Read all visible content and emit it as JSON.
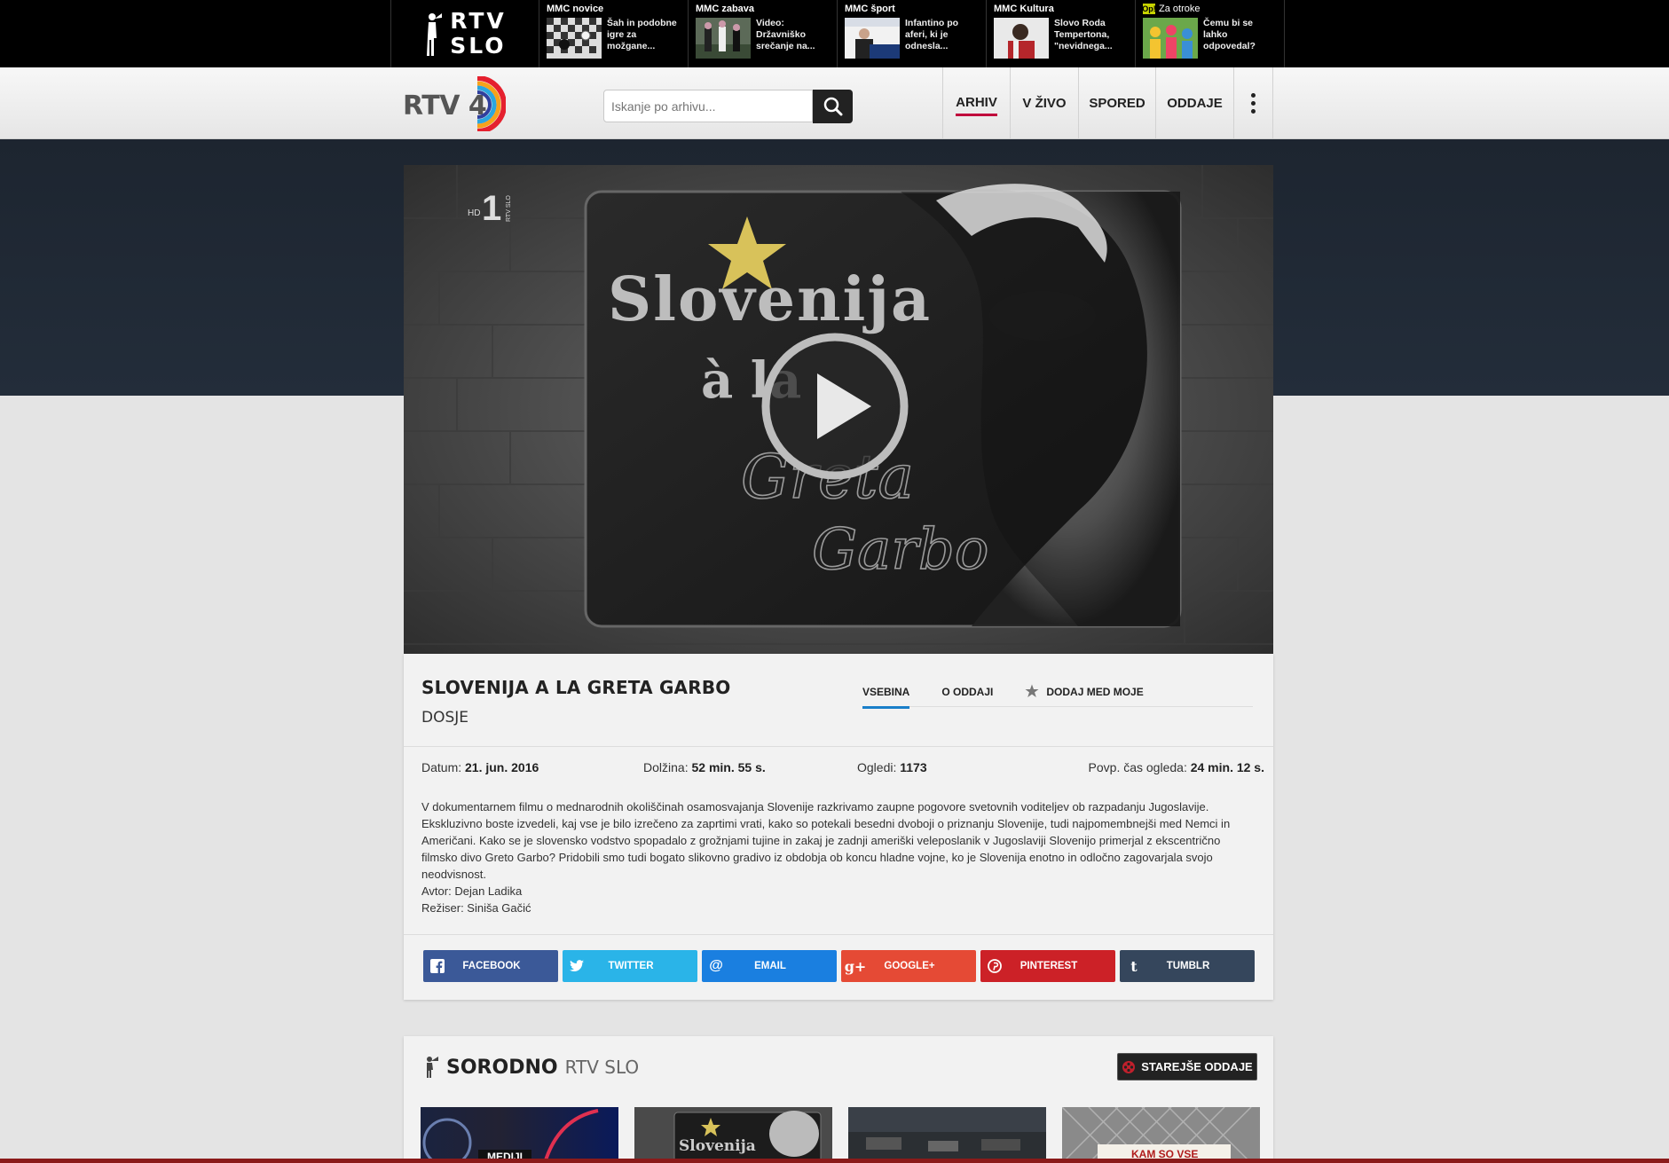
{
  "topbar": {
    "logo_line1": "RTV",
    "logo_line2": "SLO",
    "news": [
      {
        "category": "MMC novice",
        "title": "Šah in podobne igre za možgane..."
      },
      {
        "category": "MMC zabava",
        "title": "Video: Državniško srečanje na..."
      },
      {
        "category": "MMC šport",
        "title": "Infantino po aferi, ki je odnesla..."
      },
      {
        "category": "MMC Kultura",
        "title": "Slovo Roda Tempertona, \"nevidnega..."
      },
      {
        "category": "Za otroke",
        "title": "Čemu bi se lahko odpovedal?",
        "badge": "Op!"
      }
    ]
  },
  "nav": {
    "logo_text": "RTV 4",
    "search_placeholder": "Iskanje po arhivu...",
    "items": [
      {
        "label": "ARHIV",
        "active": true
      },
      {
        "label": "V ŽIVO"
      },
      {
        "label": "SPORED"
      },
      {
        "label": "ODDAJE"
      }
    ]
  },
  "player": {
    "channel_tag": "HD",
    "channel_num": "1",
    "channel_small": "RTV SLO",
    "poster_line1": "Slovenija",
    "poster_line2": "à la",
    "poster_line3": "Greta",
    "poster_line4": "Garbo"
  },
  "show": {
    "title": "SLOVENIJA A LA GRETA GARBO",
    "subtitle": "DOSJE",
    "tabs": [
      {
        "label": "VSEBINA",
        "active": true
      },
      {
        "label": "O ODDAJI"
      },
      {
        "label": "DODAJ MED MOJE",
        "icon": "star-icon"
      }
    ],
    "meta": {
      "date_label": "Datum:",
      "date_value": "21. jun. 2016",
      "length_label": "Dolžina:",
      "length_value": "52 min. 55 s.",
      "views_label": "Ogledi:",
      "views_value": "1173",
      "avg_label": "Povp. čas ogleda:",
      "avg_value": "24 min. 12 s."
    },
    "description": "V dokumentarnem filmu o mednarodnih okoliščinah osamosvajanja Slovenije razkrivamo zaupne pogovore svetovnih voditeljev ob razpadanju Jugoslavije. Ekskluzivno boste izvedeli, kaj vse je bilo izrečeno za zaprtimi vrati, kako so potekali besedni dvoboji o priznanju Slovenije, tudi najpomembnejši med Nemci in Američani. Kako se je slovensko vodstvo spopadalo z grožnjami tujine in zakaj je zadnji ameriški veleposlanik v Jugoslaviji Slovenijo primerjal z ekscentrično filmsko divo Greto Garbo? Pridobili smo tudi bogato slikovno gradivo iz obdobja ob koncu hladne vojne, ko je Slovenija enotno in odločno zagovarjala svojo neodvisnost.",
    "author": "Avtor: Dejan Ladika",
    "director": "Režiser: Siniša Gačić"
  },
  "share": [
    {
      "label": "FACEBOOK",
      "icon": "f",
      "color": "#3b5998"
    },
    {
      "label": "TWITTER",
      "icon": "t",
      "color": "#2ab4e8"
    },
    {
      "label": "EMAIL",
      "icon": "@",
      "color": "#1a7fe0"
    },
    {
      "label": "GOOGLE+",
      "icon": "g+",
      "color": "#e54a35"
    },
    {
      "label": "PINTEREST",
      "icon": "p",
      "color": "#cc2127"
    },
    {
      "label": "TUMBLR",
      "icon": "t",
      "color": "#35465c"
    }
  ],
  "related": {
    "title": "SORODNO",
    "subtitle": "RTV SLO",
    "older_button": "STAREJŠE ODDAJE",
    "thumbs": [
      {
        "caption": "MEDIJI"
      },
      {
        "caption": "Slovenija"
      },
      {
        "caption": ""
      },
      {
        "caption": "KAM SO VSE"
      }
    ]
  }
}
